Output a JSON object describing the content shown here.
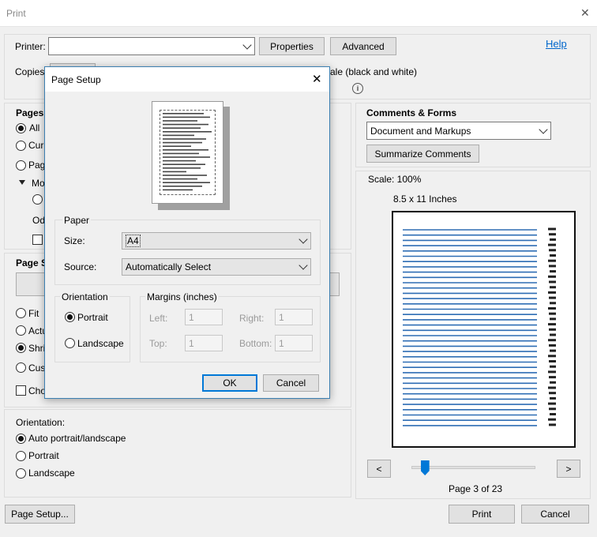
{
  "window": {
    "title": "Print",
    "close": "✕"
  },
  "top": {
    "printer_label": "Printer:",
    "printer_value": "",
    "properties": "Properties",
    "advanced": "Advanced",
    "help": "Help",
    "copies_label": "Copies",
    "grayscale_label": "ale (black and white)"
  },
  "pages": {
    "header": "Pages",
    "all": "All",
    "current": "Cur",
    "pages": "Pag",
    "more": "Mo",
    "odd": "Od"
  },
  "size": {
    "header": "Page S",
    "fit": "Fit",
    "actual": "Actu",
    "shrink": "Shri",
    "custom": "Cus",
    "choose": "Cho"
  },
  "orientation": {
    "header": "Orientation:",
    "auto": "Auto portrait/landscape",
    "portrait": "Portrait",
    "landscape": "Landscape"
  },
  "comments": {
    "header": "Comments & Forms",
    "selected": "Document and Markups",
    "summarize": "Summarize Comments"
  },
  "preview": {
    "scale": "Scale: 100%",
    "paper_size": "8.5 x 11 Inches",
    "prev": "<",
    "next": ">",
    "page_info": "Page 3 of 23",
    "slider_position": 0.08
  },
  "footer": {
    "page_setup": "Page Setup...",
    "print": "Print",
    "cancel": "Cancel"
  },
  "dialog": {
    "title": "Page Setup",
    "close": "✕",
    "paper_group": "Paper",
    "size_label": "Size:",
    "size_value": "A4",
    "source_label": "Source:",
    "source_value": "Automatically Select",
    "orientation_group": "Orientation",
    "portrait": "Portrait",
    "landscape": "Landscape",
    "margins_group": "Margins (inches)",
    "left_label": "Left:",
    "left_value": "1",
    "right_label": "Right:",
    "right_value": "1",
    "top_label": "Top:",
    "top_value": "1",
    "bottom_label": "Bottom:",
    "bottom_value": "1",
    "ok": "OK",
    "cancel": "Cancel"
  },
  "colors": {
    "accent": "#0078d7",
    "link": "#0066cc",
    "preview_line": "#2e6db4"
  }
}
